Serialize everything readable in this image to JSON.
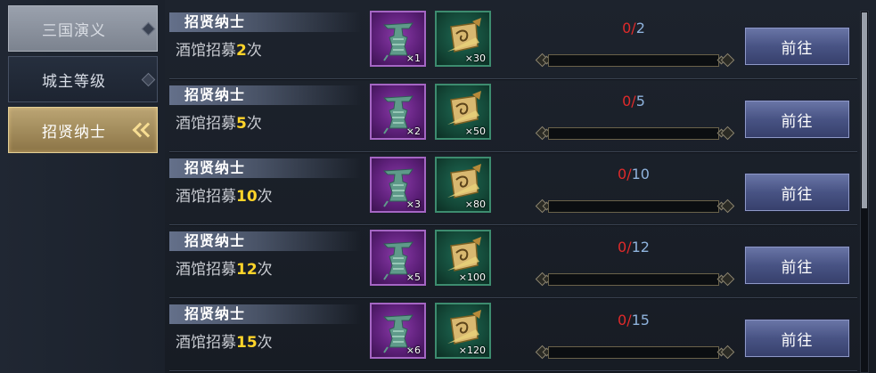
{
  "sidebar": {
    "tabs": [
      {
        "label": "三国演义",
        "state": "disabled"
      },
      {
        "label": "城主等级",
        "state": "normal"
      },
      {
        "label": "招贤纳士",
        "state": "selected"
      }
    ]
  },
  "tasks": [
    {
      "title": "招贤纳士",
      "desc_prefix": "酒馆招募",
      "desc_num": "2",
      "desc_suffix": "次",
      "rewards": [
        {
          "icon": "bronze-vessel-icon",
          "qty": "×1"
        },
        {
          "icon": "scroll-icon",
          "qty": "×30"
        }
      ],
      "progress": {
        "current": "0",
        "sep": "/",
        "total": "2",
        "fraction": 0
      },
      "button": "前往"
    },
    {
      "title": "招贤纳士",
      "desc_prefix": "酒馆招募",
      "desc_num": "5",
      "desc_suffix": "次",
      "rewards": [
        {
          "icon": "bronze-vessel-icon",
          "qty": "×2"
        },
        {
          "icon": "scroll-icon",
          "qty": "×50"
        }
      ],
      "progress": {
        "current": "0",
        "sep": "/",
        "total": "5",
        "fraction": 0
      },
      "button": "前往"
    },
    {
      "title": "招贤纳士",
      "desc_prefix": "酒馆招募",
      "desc_num": "10",
      "desc_suffix": "次",
      "rewards": [
        {
          "icon": "bronze-vessel-icon",
          "qty": "×3"
        },
        {
          "icon": "scroll-icon",
          "qty": "×80"
        }
      ],
      "progress": {
        "current": "0",
        "sep": "/",
        "total": "10",
        "fraction": 0
      },
      "button": "前往"
    },
    {
      "title": "招贤纳士",
      "desc_prefix": "酒馆招募",
      "desc_num": "12",
      "desc_suffix": "次",
      "rewards": [
        {
          "icon": "bronze-vessel-icon",
          "qty": "×5"
        },
        {
          "icon": "scroll-icon",
          "qty": "×100"
        }
      ],
      "progress": {
        "current": "0",
        "sep": "/",
        "total": "12",
        "fraction": 0
      },
      "button": "前往"
    },
    {
      "title": "招贤纳士",
      "desc_prefix": "酒馆招募",
      "desc_num": "15",
      "desc_suffix": "次",
      "rewards": [
        {
          "icon": "bronze-vessel-icon",
          "qty": "×6"
        },
        {
          "icon": "scroll-icon",
          "qty": "×120"
        }
      ],
      "progress": {
        "current": "0",
        "sep": "/",
        "total": "15",
        "fraction": 0
      },
      "button": "前往"
    }
  ],
  "colors": {
    "progress_current": "#e02a2a",
    "progress_total": "#8fb3dd",
    "desc_highlight": "#ffd42a",
    "button_bg": "#485384",
    "selected_tab": "#bba574"
  },
  "scrollbar": {
    "position_fraction": 0
  }
}
